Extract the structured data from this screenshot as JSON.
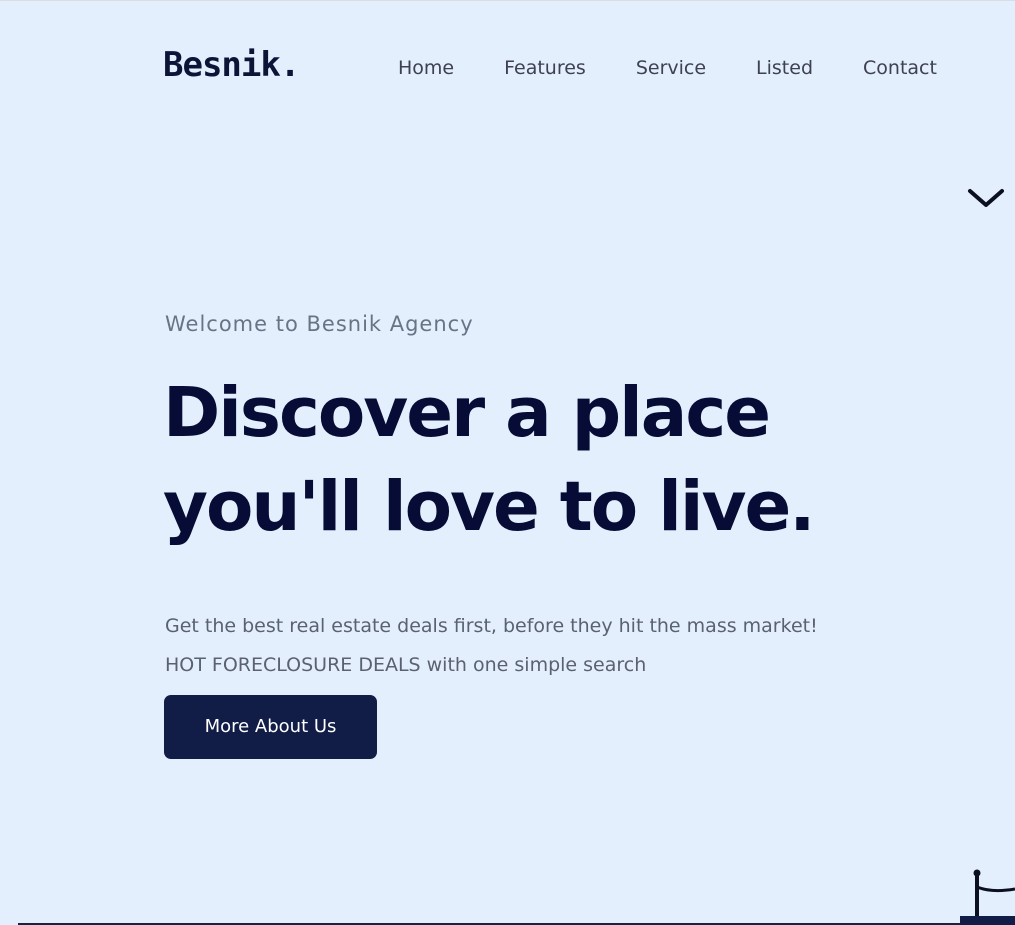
{
  "header": {
    "logo": "Besnik.",
    "nav": [
      "Home",
      "Features",
      "Service",
      "Listed",
      "Contact"
    ]
  },
  "hero": {
    "eyebrow": "Welcome to Besnik Agency",
    "headline_line1": "Discover a place",
    "headline_line2": "you'll love to live.",
    "description": "Get the best real estate deals first, before they hit the mass market! HOT FORECLOSURE DEALS with one simple search",
    "cta_label": "More About Us"
  },
  "icons": {
    "scroll": "chevron-down-icon",
    "corner": "decorative-chair-illustration"
  },
  "colors": {
    "background": "#e3effd",
    "headline": "#060c35",
    "button": "#111c47",
    "eyebrow": "#6a7385",
    "body_text": "#5b6170"
  }
}
